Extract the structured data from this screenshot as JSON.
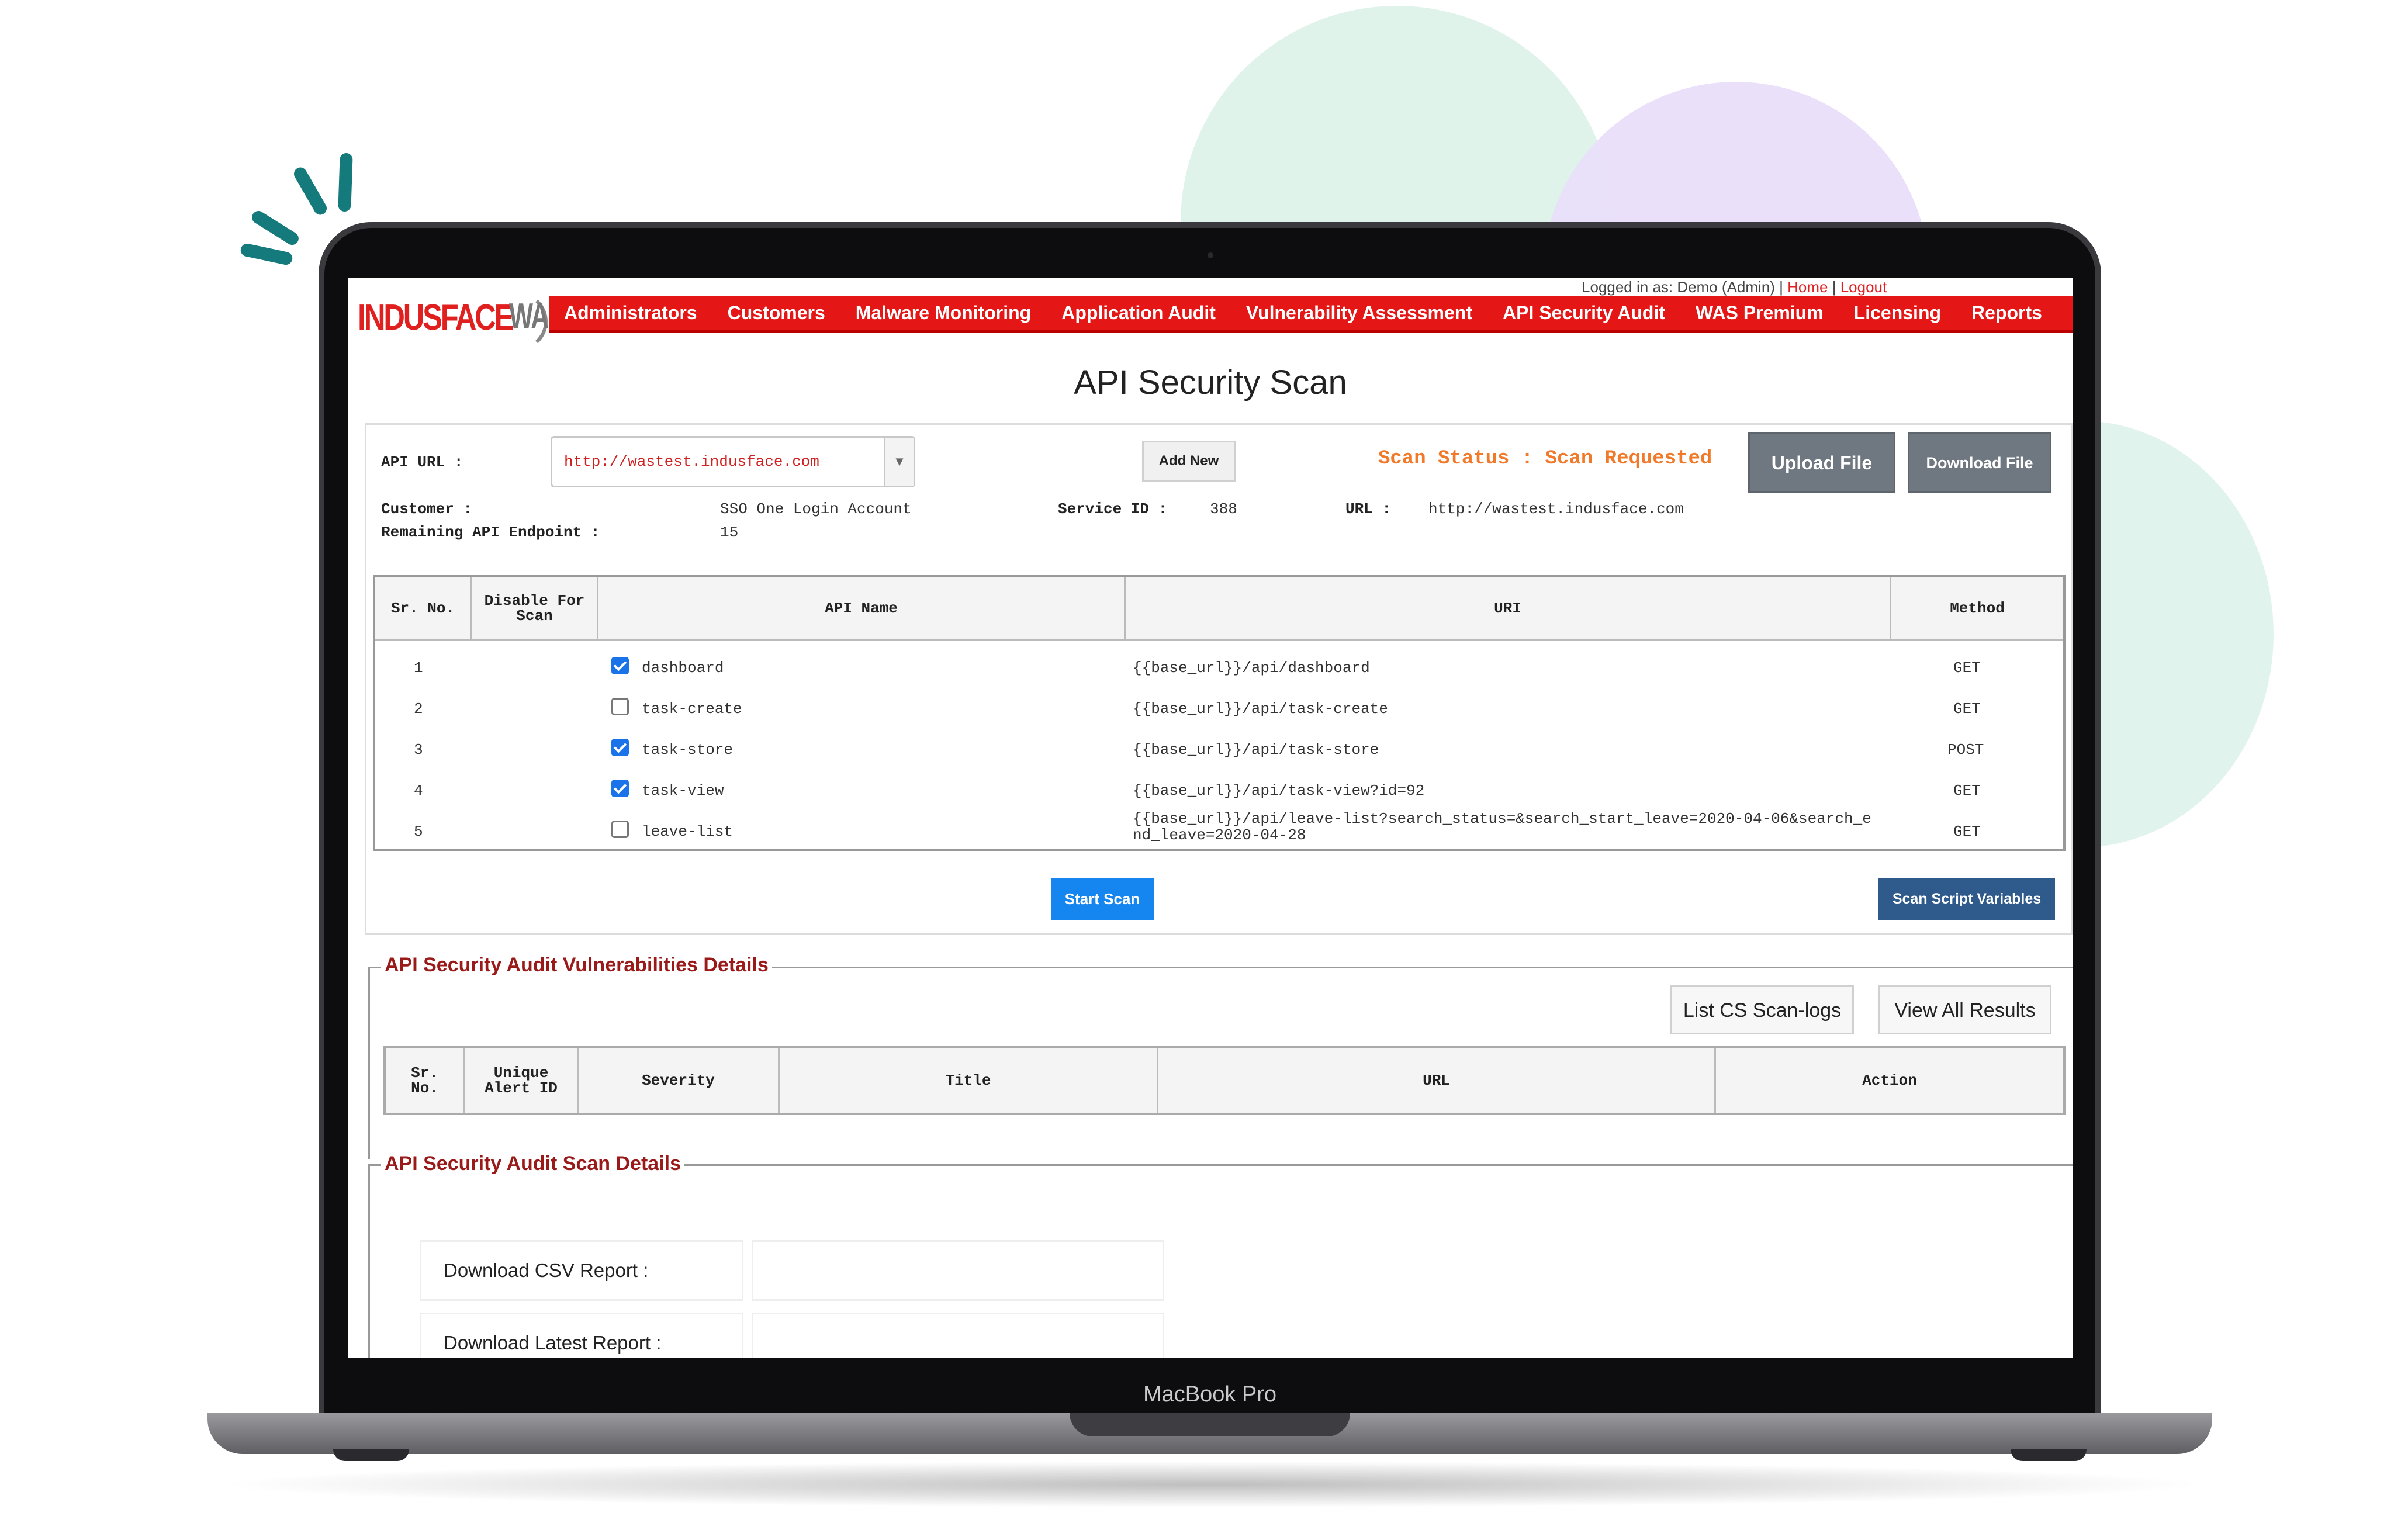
{
  "device_label": "MacBook Pro",
  "topbar": {
    "text": "Logged in as: Demo (Admin) | ",
    "home": "Home",
    "logout": "Logout"
  },
  "logo": {
    "brand": "INDUSFACE",
    "product": "WAS"
  },
  "nav": [
    "Administrators",
    "Customers",
    "Malware Monitoring",
    "Application Audit",
    "Vulnerability Assessment",
    "API Security Audit",
    "WAS Premium",
    "Licensing",
    "Reports"
  ],
  "page_title": "API Security Scan",
  "form": {
    "api_url_label": "API URL :",
    "api_url_value": "http://wastest.indusface.com",
    "add_new": "Add New",
    "scan_status": "Scan Status : Scan Requested",
    "upload_file": "Upload File",
    "download_file": "Download File",
    "customer_label": "Customer :",
    "customer_value": "SSO One Login Account",
    "remaining_label": "Remaining API Endpoint :",
    "remaining_value": "15",
    "service_id_label": "Service ID :",
    "service_id_value": "388",
    "url_label": "URL :",
    "url_value": "http://wastest.indusface.com"
  },
  "api_table": {
    "headers": {
      "sr": "Sr. No.",
      "disable_1": "Disable For",
      "disable_2": "Scan",
      "api_name": "API Name",
      "uri": "URI",
      "method": "Method"
    },
    "rows": [
      {
        "sr": "1",
        "checked": true,
        "name": "dashboard",
        "uri": "{{base_url}}/api/dashboard",
        "method": "GET"
      },
      {
        "sr": "2",
        "checked": false,
        "name": "task-create",
        "uri": "{{base_url}}/api/task-create",
        "method": "GET"
      },
      {
        "sr": "3",
        "checked": true,
        "name": "task-store",
        "uri": "{{base_url}}/api/task-store",
        "method": "POST"
      },
      {
        "sr": "4",
        "checked": true,
        "name": "task-view",
        "uri": "{{base_url}}/api/task-view?id=92",
        "method": "GET"
      },
      {
        "sr": "5",
        "checked": false,
        "name": "leave-list",
        "uri": "{{base_url}}/api/leave-list?search_status=&search_start_leave=2020-04-06&search_e",
        "uri_2": "nd_leave=2020-04-28",
        "method": "GET"
      }
    ]
  },
  "start_scan": "Start Scan",
  "scan_script_variables": "Scan Script Variables",
  "vuln_section": {
    "legend": "API Security Audit Vulnerabilities Details",
    "list_logs": "List CS Scan-logs",
    "view_all": "View All Results",
    "headers": {
      "sr_1": "Sr.",
      "sr_2": "No.",
      "alert_1": "Unique",
      "alert_2": "Alert ID",
      "severity": "Severity",
      "title": "Title",
      "url": "URL",
      "action": "Action"
    }
  },
  "scan_section": {
    "legend": "API Security Audit Scan Details",
    "download_csv": "Download CSV Report :",
    "download_latest": "Download Latest Report :"
  },
  "colors": {
    "nav_red": "#e41616",
    "status_orange": "#f07a2a",
    "legend_red": "#9a1a1a",
    "start_blue": "#1585f0",
    "navy": "#2e5b8c"
  }
}
